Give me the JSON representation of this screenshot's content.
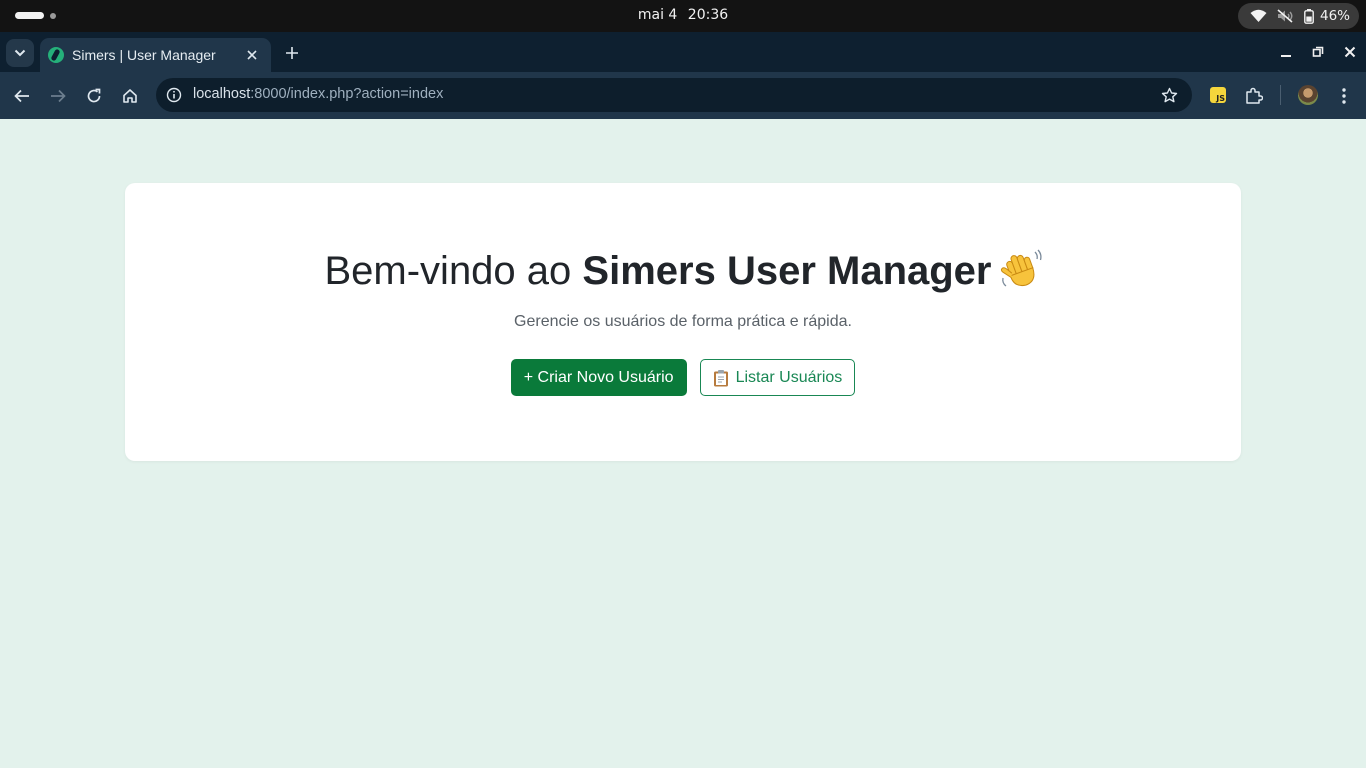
{
  "system": {
    "date": "mai 4",
    "time": "20:36",
    "battery": "46%"
  },
  "browser": {
    "tab_title": "Simers | User Manager",
    "url_host": "localhost",
    "url_rest": ":8000/index.php?action=index"
  },
  "page": {
    "title_prefix": "Bem-vindo ao ",
    "title_bold": "Simers User Manager",
    "subtitle": "Gerencie os usuários de forma prática e rápida.",
    "primary_button": "+ Criar Novo Usuário",
    "secondary_button": "Listar Usuários"
  },
  "colors": {
    "page_background": "#e3f2ec",
    "primary": "#0a7a3a",
    "outline": "#198754"
  }
}
